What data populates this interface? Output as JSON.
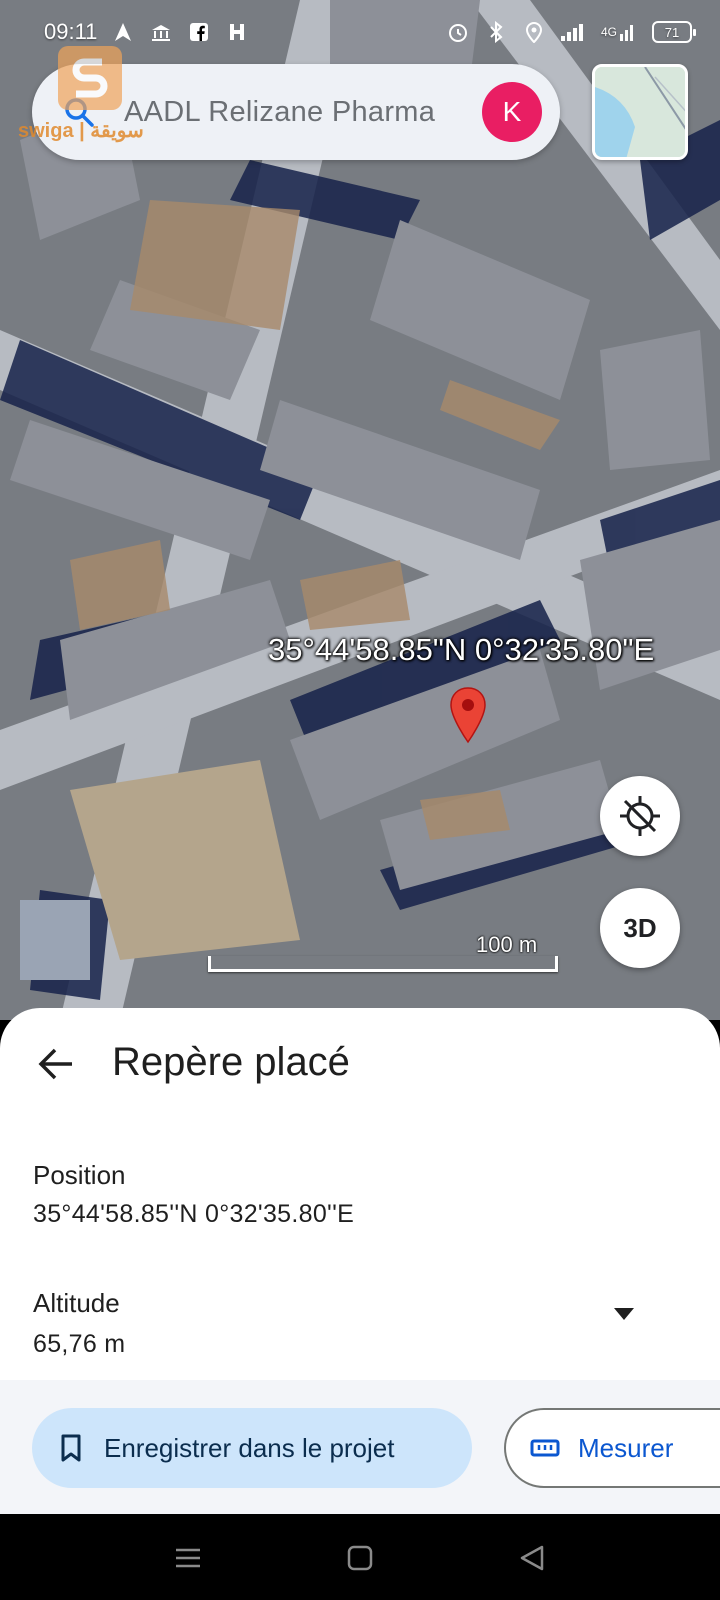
{
  "status_bar": {
    "time": "09:11",
    "battery": "71",
    "network": "4G",
    "left_icons": [
      "navigation-icon",
      "bank-icon",
      "facebook-icon",
      "h-app-icon"
    ],
    "right_icons": [
      "alarm-icon",
      "bluetooth-icon",
      "location-icon",
      "signal-icon",
      "wifi-icon",
      "battery-icon"
    ]
  },
  "search": {
    "text": "AADL Relizane Pharma",
    "avatar_initial": "K",
    "avatar_color": "#e91e63"
  },
  "watermark": {
    "text": "swiga | سويقة"
  },
  "map": {
    "coordinates": "35°44'58.85\"N 0°32'35.80\"E",
    "scale_label": "100 m",
    "button_3d": "3D",
    "pin_color": "#ea4335"
  },
  "sheet": {
    "title": "Repère placé",
    "position_label": "Position",
    "position_value": "35°44'58.85''N 0°32'35.80''E",
    "altitude_label": "Altitude",
    "altitude_value": "65,76 m",
    "save_label": "Enregistrer dans le projet",
    "measure_label": "Mesurer"
  },
  "colors": {
    "accent_blue": "#0b57d0",
    "save_bg": "#cde5fb"
  }
}
